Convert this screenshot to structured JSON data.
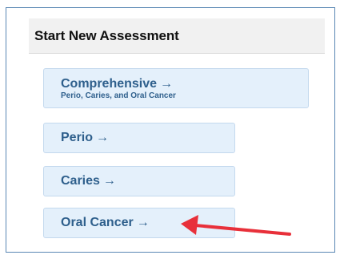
{
  "assessment": {
    "title": "Start New Assessment",
    "buttons": [
      {
        "label": "Comprehensive",
        "arrow": "→",
        "sublabel": "Perio, Caries, and Oral Cancer"
      },
      {
        "label": "Perio",
        "arrow": "→"
      },
      {
        "label": "Caries",
        "arrow": "→"
      },
      {
        "label": "Oral Cancer",
        "arrow": "→"
      }
    ]
  },
  "annotation": {
    "icon": "red-arrow-icon",
    "color": "#e8303a",
    "points_to": "Oral Cancer"
  },
  "colors": {
    "frame_border": "#5a87b4",
    "header_bg": "#f1f1f1",
    "button_bg": "#e4f0fb",
    "button_border": "#c4d9ee",
    "button_text": "#2e5f8c"
  }
}
